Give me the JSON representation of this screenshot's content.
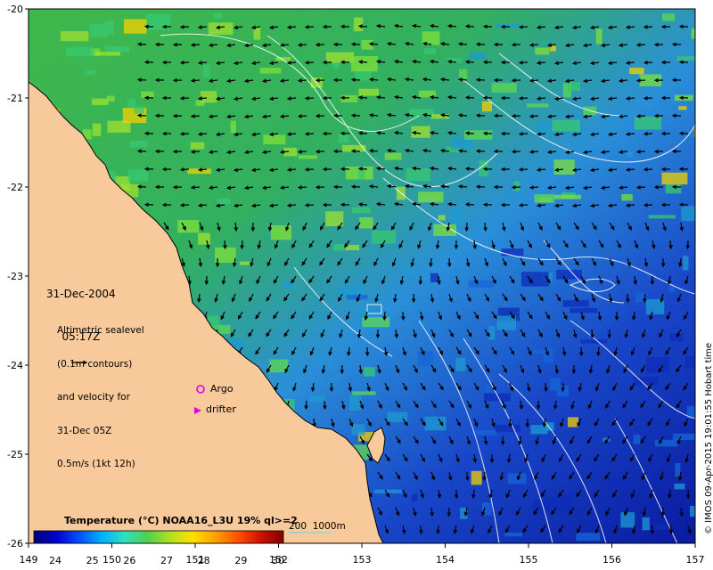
{
  "map": {
    "date": "31-Dec-2004",
    "time": "05:17Z",
    "annotation_lines": [
      "Altimetric sealevel",
      "(0.1m contours)",
      "and velocity for",
      "31-Dec 05Z",
      "0.5m/s (1kt 12h)"
    ],
    "x_ticks": [
      "149",
      "150",
      "151",
      "152",
      "153",
      "154",
      "155",
      "156",
      "157"
    ],
    "y_ticks": [
      "-20",
      "-21",
      "-22",
      "-23",
      "-24",
      "-25",
      "-26"
    ],
    "legend_argo": "Argo",
    "legend_drifter": "drifter",
    "colorbar_title": "Temperature (°C) NOAA16_L3U 19% ql>=2",
    "colorbar_ticks": [
      "24",
      "25",
      "26",
      "27",
      "28",
      "29",
      "30"
    ],
    "depth_scale_label": "200  1000m",
    "copyright": "© IMOS 09-Apr-2015 19:01:55 Hobart time"
  },
  "colors": {
    "land": "#f8c99a",
    "argo_marker": "#e000e0",
    "drifter_marker": "#e000e0",
    "depth_line": "#7fd4d8",
    "contour": "#ffffff"
  },
  "colorbar": {
    "stops": [
      "#00007f",
      "#0000d0",
      "#0050ff",
      "#00b0ff",
      "#30e0c0",
      "#50d050",
      "#b0e020",
      "#ffe000",
      "#ffa000",
      "#ff5000",
      "#d01000",
      "#800000"
    ]
  }
}
